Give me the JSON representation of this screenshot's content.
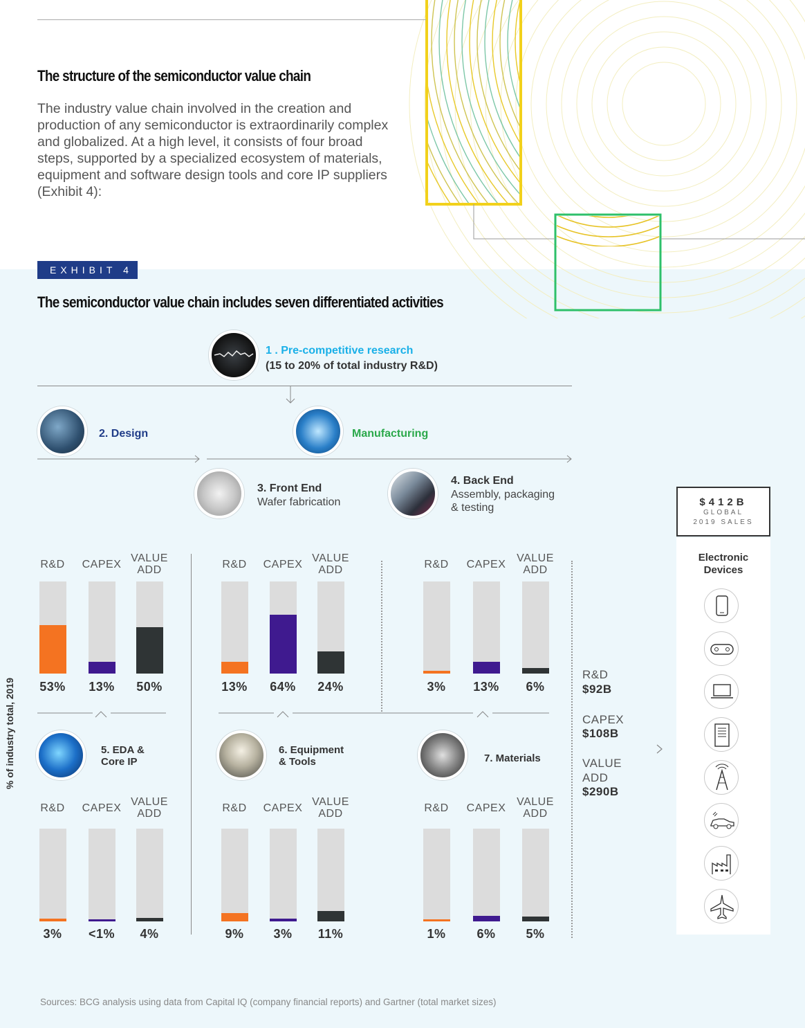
{
  "header": {
    "title": "The structure of the semiconductor value chain",
    "intro": "The industry value chain involved in the creation and production of any semiconductor is extraordinarily complex and globalized. At a high level, it consists of four broad steps, supported by a specialized ecosystem of materials, equipment and software design tools and core IP suppliers (Exhibit 4):"
  },
  "exhibit": {
    "tag": "EXHIBIT 4",
    "title": "The semiconductor value chain includes seven differentiated activities"
  },
  "steps": {
    "research": {
      "title": "1 . Pre-competitive research",
      "sub": "(15 to 20% of total industry R&D)",
      "color": "#1ab0e8"
    },
    "design": {
      "title": "2. Design",
      "color": "#1f3c88"
    },
    "manufacturing": {
      "title": "Manufacturing",
      "color": "#2aa84a"
    },
    "front_end": {
      "title": "3. Front End",
      "sub": "Wafer fabrication"
    },
    "back_end": {
      "title": "4. Back End",
      "sub1": "Assembly, packaging",
      "sub2": "& testing"
    },
    "eda": {
      "title1": "5. EDA &",
      "title2": "Core IP"
    },
    "equipment": {
      "title1": "6. Equipment",
      "title2": "& Tools"
    },
    "materials": {
      "title": "7. Materials"
    }
  },
  "columns": {
    "rd": "R&D",
    "capex": "CAPEX",
    "va1": "VALUE",
    "va2": "ADD"
  },
  "chart_data": [
    {
      "type": "bar",
      "title": "2. Design",
      "categories": [
        "R&D",
        "CAPEX",
        "VALUE ADD"
      ],
      "values": [
        53,
        13,
        50
      ],
      "labels": [
        "53%",
        "13%",
        "50%"
      ],
      "ylim": [
        0,
        100
      ],
      "colors": [
        "#f47321",
        "#3f1a8f",
        "#2f3435"
      ]
    },
    {
      "type": "bar",
      "title": "3. Front End",
      "categories": [
        "R&D",
        "CAPEX",
        "VALUE ADD"
      ],
      "values": [
        13,
        64,
        24
      ],
      "labels": [
        "13%",
        "64%",
        "24%"
      ],
      "ylim": [
        0,
        100
      ],
      "colors": [
        "#f47321",
        "#3f1a8f",
        "#2f3435"
      ]
    },
    {
      "type": "bar",
      "title": "4. Back End",
      "categories": [
        "R&D",
        "CAPEX",
        "VALUE ADD"
      ],
      "values": [
        3,
        13,
        6
      ],
      "labels": [
        "3%",
        "13%",
        "6%"
      ],
      "ylim": [
        0,
        100
      ],
      "colors": [
        "#f47321",
        "#3f1a8f",
        "#2f3435"
      ]
    },
    {
      "type": "bar",
      "title": "5. EDA & Core IP",
      "categories": [
        "R&D",
        "CAPEX",
        "VALUE ADD"
      ],
      "values": [
        3,
        0.5,
        4
      ],
      "labels": [
        "3%",
        "<1%",
        "4%"
      ],
      "ylim": [
        0,
        100
      ],
      "colors": [
        "#f47321",
        "#3f1a8f",
        "#2f3435"
      ]
    },
    {
      "type": "bar",
      "title": "6. Equipment & Tools",
      "categories": [
        "R&D",
        "CAPEX",
        "VALUE ADD"
      ],
      "values": [
        9,
        3,
        11
      ],
      "labels": [
        "9%",
        "3%",
        "11%"
      ],
      "ylim": [
        0,
        100
      ],
      "colors": [
        "#f47321",
        "#3f1a8f",
        "#2f3435"
      ]
    },
    {
      "type": "bar",
      "title": "7. Materials",
      "categories": [
        "R&D",
        "CAPEX",
        "VALUE ADD"
      ],
      "values": [
        1,
        6,
        5
      ],
      "labels": [
        "1%",
        "6%",
        "5%"
      ],
      "ylim": [
        0,
        100
      ],
      "colors": [
        "#f47321",
        "#3f1a8f",
        "#2f3435"
      ]
    }
  ],
  "totals": {
    "rd_label": "R&D",
    "rd_value": "$92B",
    "capex_label": "CAPEX",
    "capex_value": "$108B",
    "va_label1": "VALUE",
    "va_label2": "ADD",
    "va_value": "$290B"
  },
  "sales": {
    "main": "$412B",
    "sub1": "GLOBAL",
    "sub2": "2019 SALES"
  },
  "devices": {
    "title1": "Electronic",
    "title2": "Devices",
    "icons": [
      "smartphone-icon",
      "gamepad-icon",
      "laptop-icon",
      "server-icon",
      "antenna-tower-icon",
      "electric-car-icon",
      "factory-icon",
      "airplane-icon"
    ]
  },
  "y_axis_label": "% of industry total, 2019",
  "source": "Sources: BCG analysis using data from Capital IQ (company financial reports) and Gartner (total market sizes)"
}
